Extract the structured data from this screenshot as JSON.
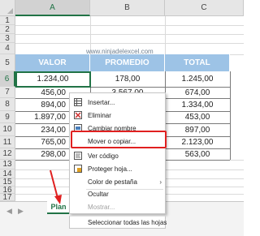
{
  "columns": [
    "A",
    "B",
    "C"
  ],
  "rows": [
    "1",
    "2",
    "3",
    "4",
    "5",
    "6",
    "7",
    "8",
    "9",
    "10",
    "11",
    "12",
    "13",
    "14",
    "15",
    "16",
    "17",
    "18"
  ],
  "watermark": "www.ninjadelexcel.com",
  "table": {
    "headers": [
      "VALOR",
      "PROMEDIO",
      "TOTAL"
    ],
    "rows": [
      [
        "1.234,00",
        "178,00",
        "1.245,00"
      ],
      [
        "456,00",
        "3.567,00",
        "674,00"
      ],
      [
        "894,00",
        "",
        "1.334,00"
      ],
      [
        "1.897,00",
        "",
        "453,00"
      ],
      [
        "234,00",
        "",
        "897,00"
      ],
      [
        "765,00",
        "",
        "2.123,00"
      ],
      [
        "298,00",
        "",
        "563,00"
      ]
    ]
  },
  "context_menu": {
    "items": [
      {
        "label": "Insertar...",
        "icon": "insert-sheet-icon",
        "enabled": true
      },
      {
        "label": "Eliminar",
        "icon": "delete-sheet-icon",
        "enabled": true
      },
      {
        "label": "Cambiar nombre",
        "icon": "rename-sheet-icon",
        "enabled": true
      },
      {
        "label": "Mover o copiar...",
        "icon": "",
        "enabled": true
      },
      {
        "label": "Ver código",
        "icon": "view-code-icon",
        "enabled": true
      },
      {
        "label": "Proteger hoja...",
        "icon": "protect-sheet-icon",
        "enabled": true
      },
      {
        "label": "Color de pestaña",
        "icon": "",
        "enabled": true
      },
      {
        "label": "Ocultar",
        "icon": "",
        "enabled": true
      },
      {
        "label": "Mostrar...",
        "icon": "",
        "enabled": false
      },
      {
        "label": "Seleccionar todas las hojas",
        "icon": "",
        "enabled": true
      }
    ],
    "submenu_glyph": "›"
  },
  "sheet_tab": {
    "label": "Plan",
    "add_glyph": "+"
  },
  "colors": {
    "accent": "#217346",
    "table_header": "#9dc3e6",
    "highlight": "#e02020"
  }
}
